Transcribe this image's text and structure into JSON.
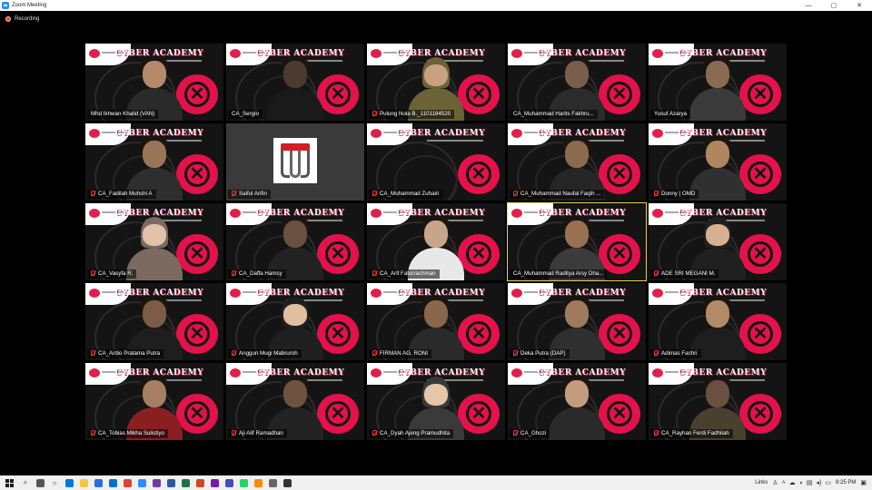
{
  "window": {
    "title": "Zoom Meeting",
    "controls": {
      "minimize": "—",
      "maximize": "▢",
      "close": "✕"
    }
  },
  "recording": {
    "label": "Recording"
  },
  "participants": [
    {
      "name": "Mhd Ikhwan Khalid (VAN)",
      "muted": false,
      "style": "male",
      "skin": "#b48a6a",
      "shirt": "#2a2a2a"
    },
    {
      "name": "CA_Sergio",
      "muted": false,
      "style": "male",
      "skin": "#4a3a30",
      "shirt": "#1a1a1a"
    },
    {
      "name": "Pulung Nola B._1101184520",
      "muted": true,
      "style": "hijab",
      "skin": "#c9a080",
      "shirt": "#6b6236"
    },
    {
      "name": "CA_Muhammad Harits Fakhru...",
      "muted": false,
      "style": "male",
      "skin": "#7a5e4a",
      "shirt": "#2b2b2b"
    },
    {
      "name": "Yusuf Azarya",
      "muted": false,
      "style": "male",
      "skin": "#8a6a52",
      "shirt": "#3a3a3a"
    },
    {
      "name": "CA_Fadilah Muhshi A",
      "muted": true,
      "style": "male",
      "skin": "#9a7456",
      "shirt": "#2e2e2e"
    },
    {
      "name": "Saiful Arifin",
      "muted": true,
      "style": "logo",
      "skin": "",
      "shirt": ""
    },
    {
      "name": "CA_Muhammad Zuhairi",
      "muted": true,
      "style": "empty",
      "skin": "",
      "shirt": ""
    },
    {
      "name": "CA_Muhammad Naufal Faqih ...",
      "muted": true,
      "style": "male",
      "skin": "#8c6a4e",
      "shirt": "#262626"
    },
    {
      "name": "Donny | OMD",
      "muted": true,
      "style": "male",
      "skin": "#b08660",
      "shirt": "#303030"
    },
    {
      "name": "CA_Vasyfa R.",
      "muted": true,
      "style": "hijab",
      "skin": "#e2c2a8",
      "shirt": "#7a6a60"
    },
    {
      "name": "CA_Daffa Hamsy",
      "muted": true,
      "style": "male",
      "skin": "#6a5040",
      "shirt": "#222222"
    },
    {
      "name": "CA_Arif Faturrachman",
      "muted": true,
      "style": "male",
      "skin": "#c8a48a",
      "shirt": "#e8e8e8"
    },
    {
      "name": "CA_Muhammad Raditya Arsy Dha...",
      "muted": false,
      "style": "male",
      "skin": "#9a7052",
      "shirt": "#3b3b3b"
    },
    {
      "name": "ADE SRI MEGANI M.",
      "muted": true,
      "style": "hijab",
      "skin": "#d8b090",
      "shirt": "#202020"
    },
    {
      "name": "CA_Ardio Pratama Putra",
      "muted": true,
      "style": "male",
      "skin": "#7c5c44",
      "shirt": "#1e1e1e"
    },
    {
      "name": "Anggun Mugi Mabruroh",
      "muted": true,
      "style": "hijab",
      "skin": "#e0bea0",
      "shirt": "#1f1f1f"
    },
    {
      "name": "FIRMAN AG. RONI",
      "muted": true,
      "style": "male",
      "skin": "#8a664c",
      "shirt": "#2a2a2a"
    },
    {
      "name": "Deka Putra (DAP)",
      "muted": true,
      "style": "male",
      "skin": "#a07a5c",
      "shirt": "#2f2f2f"
    },
    {
      "name": "Adimas Fachri",
      "muted": true,
      "style": "male",
      "skin": "#b28a68",
      "shirt": "#1e1e1e"
    },
    {
      "name": "CA_Tobias Mikha Sulistiyo",
      "muted": true,
      "style": "male",
      "skin": "#a67e62",
      "shirt": "#8a1f22"
    },
    {
      "name": "Aji Alif Ramadhan",
      "muted": true,
      "style": "male",
      "skin": "#6e5240",
      "shirt": "#232323"
    },
    {
      "name": "CA_Dyah Ajeng Pramudhita",
      "muted": true,
      "style": "hijab",
      "skin": "#e6c6a8",
      "shirt": "#3a3a3a"
    },
    {
      "name": "CA_Ghozi",
      "muted": true,
      "style": "male",
      "skin": "#c29c7c",
      "shirt": "#2a2a2a"
    },
    {
      "name": "CA_Rayhan Ferdi Fadhilah",
      "muted": true,
      "style": "male",
      "skin": "#6a5040",
      "shirt": "#4a4030"
    }
  ],
  "active_speaker_index": 13,
  "background": {
    "brand_text": "CYBER ACADEMY",
    "accent_color": "#e3124b"
  },
  "taskbar": {
    "links_label": "Links",
    "time": "8:25 PM",
    "apps": [
      "search-icon",
      "task-view-icon",
      "cortana-icon",
      "edge-icon",
      "explorer-icon",
      "store-icon",
      "mail-icon",
      "chrome-icon",
      "zoom-icon",
      "photos-icon",
      "word-icon",
      "excel-icon",
      "powerpoint-icon",
      "onenote-icon",
      "teams-icon",
      "whatsapp-icon",
      "vlc-icon",
      "settings-icon",
      "obs-icon"
    ]
  }
}
